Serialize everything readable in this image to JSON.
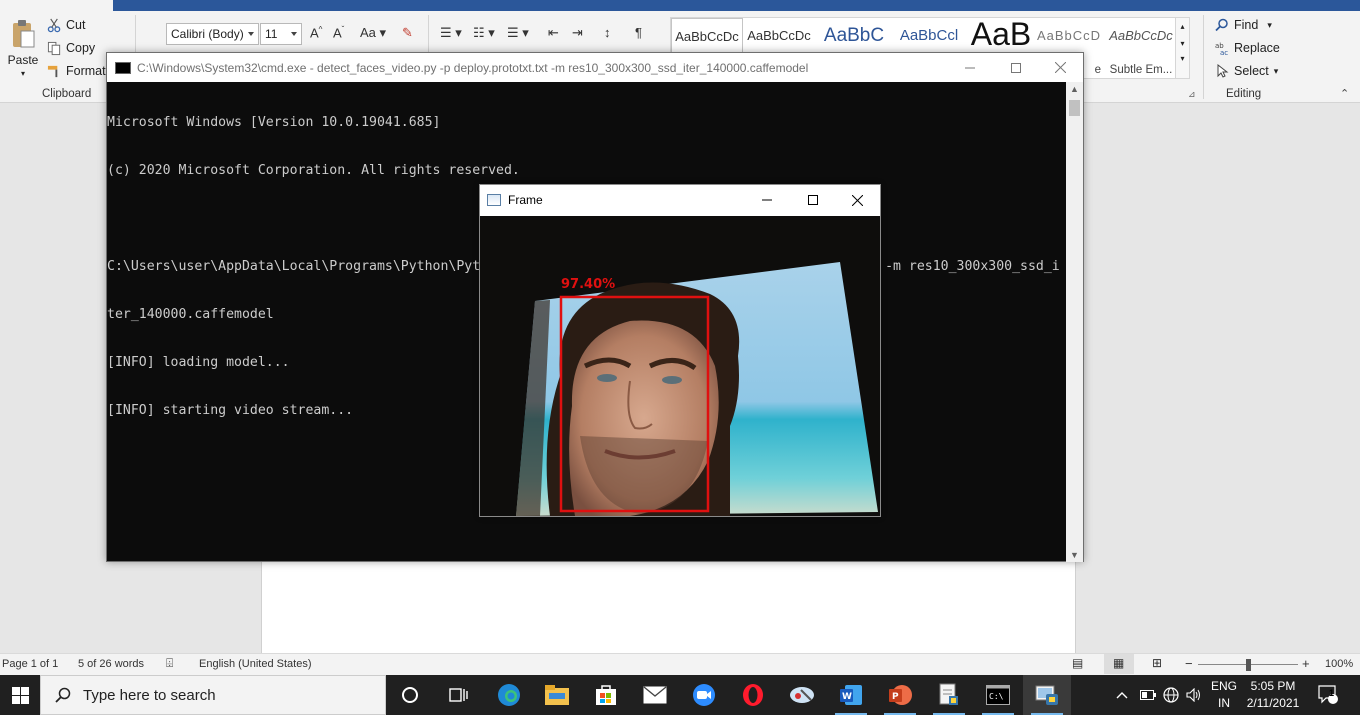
{
  "word": {
    "clipboard": {
      "paste": "Paste",
      "cut": "Cut",
      "copy": "Copy",
      "format_painter": "Format",
      "group_label": "Clipboard"
    },
    "font": {
      "name": "Calibri (Body)",
      "size": "11"
    },
    "styles": [
      {
        "sample": "AaBbCcDc",
        "name": ""
      },
      {
        "sample": "AaBbCcDc",
        "name": ""
      },
      {
        "sample": "AaBbC",
        "name": ""
      },
      {
        "sample": "AaBbCcl",
        "name": ""
      },
      {
        "sample": "AaB",
        "name": ""
      },
      {
        "sample": "AaBbCcD",
        "name": "e"
      },
      {
        "sample": "AaBbCcDc",
        "name": "Subtle Em..."
      }
    ],
    "editing": {
      "find": "Find",
      "replace": "Replace",
      "select": "Select",
      "group_label": "Editing"
    },
    "status": {
      "page": "Page 1 of 1",
      "words": "5 of 26 words",
      "language": "English (United States)",
      "zoom": "100%",
      "zoom_minus": "−",
      "zoom_plus": "+"
    }
  },
  "cmd": {
    "title": "C:\\Windows\\System32\\cmd.exe - detect_faces_video.py  -p deploy.prototxt.txt -m res10_300x300_ssd_iter_140000.caffemodel",
    "lines": [
      "Microsoft Windows [Version 10.0.19041.685]",
      "(c) 2020 Microsoft Corporation. All rights reserved.",
      "",
      "C:\\Users\\user\\AppData\\Local\\Programs\\Python\\Python39>detect_faces_video.py -p deploy.prototxt.txt -m res10_300x300_ssd_i",
      "ter_140000.caffemodel",
      "[INFO] loading model...",
      "[INFO] starting video stream..."
    ]
  },
  "frame": {
    "title": "Frame",
    "detection_label": "97.40%",
    "detection_confidence": 0.974,
    "box_color": "#e01010"
  },
  "taskbar": {
    "search_placeholder": "Type here to search",
    "apps": [
      "cortana-icon",
      "task-view-icon",
      "edge-icon",
      "file-explorer-icon",
      "store-icon",
      "mail-icon",
      "zoom-icon",
      "opera-icon",
      "snipping-icon",
      "word-icon",
      "powerpoint-icon",
      "notepad-icon",
      "cmd-icon",
      "python-icon"
    ],
    "lang_top": "ENG",
    "lang_bottom": "IN",
    "time": "5:05 PM",
    "date": "2/11/2021",
    "notifications": "1"
  },
  "colors": {
    "word_blue": "#2b579a",
    "taskbar": "#202020",
    "cmd_bg": "#0c0c0c",
    "cmd_text": "#cccccc"
  }
}
